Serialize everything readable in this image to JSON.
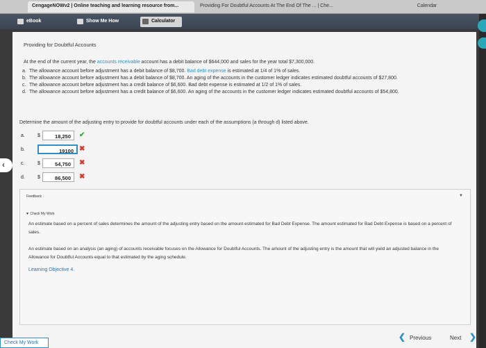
{
  "browser_tabs": [
    {
      "label": "CengageNOWv2 | Online teaching and learning resource from..."
    },
    {
      "label": "Providing For Doubtful Accounts At The End Of The ... | Che..."
    },
    {
      "label": "Calendar"
    }
  ],
  "toolbar": {
    "ebook": "eBook",
    "show_me_how": "Show Me How",
    "calculator": "Calculator"
  },
  "problem": {
    "title": "Providing for Doubtful Accounts",
    "intro_pre": "At the end of the current year, the ",
    "intro_link": "accounts receivable",
    "intro_post": " account has a debit balance of $644,000 and sales for the year total $7,300,000.",
    "items": [
      {
        "letter": "a.",
        "pre": "The allowance account before adjustment has a debit balance of $8,700. ",
        "link": "Bad debt expense",
        "post": " is estimated at 1/4 of 1% of sales."
      },
      {
        "letter": "b.",
        "pre": "The allowance account before adjustment has a debit balance of $8,700. An aging of the accounts in the customer ledger indicates estimated doubtful accounts of $27,800.",
        "link": "",
        "post": ""
      },
      {
        "letter": "c.",
        "pre": "The allowance account before adjustment has a credit balance of $6,600. Bad debt expense is estimated at 1/2 of 1% of sales.",
        "link": "",
        "post": ""
      },
      {
        "letter": "d.",
        "pre": "The allowance account before adjustment has a credit balance of $6,600. An aging of the accounts in the customer ledger indicates estimated doubtful accounts of $54,800.",
        "link": "",
        "post": ""
      }
    ],
    "determine": "Determine the amount of the adjusting entry to provide for doubtful accounts under each of the assumptions (a through d) listed above."
  },
  "answers": [
    {
      "letter": "a.",
      "currency": "$",
      "value": "18,250",
      "mark": "✔",
      "status": "correct"
    },
    {
      "letter": "b.",
      "currency": "$",
      "value": "19100",
      "mark": "✖",
      "status": "incorrect"
    },
    {
      "letter": "c.",
      "currency": "$",
      "value": "54,750",
      "mark": "✖",
      "status": "incorrect"
    },
    {
      "letter": "d.",
      "currency": "$",
      "value": "86,500",
      "mark": "✖",
      "status": "incorrect"
    }
  ],
  "feedback": {
    "label": "Feedback",
    "check_my_work": "▼ Check My Work",
    "para1": "An estimate based on a percent of sales determines the amount of the adjusting entry based on the amount estimated for Bad Debt Expense. The amount estimated for Bad Debt Expense is based on a percent of sales.",
    "para2": "An estimate based on an analysis (an aging) of accounts receivable focuses on the Allowance for Doubtful Accounts. The amount of the adjusting entry is the amount that will yield an adjusted balance in the Allowance for Doubtful Accounts equal to that estimated by the aging schedule.",
    "learning_objective": "Learning Objective 4."
  },
  "footer": {
    "check_my_work": "Check My Work",
    "previous": "Previous",
    "next": "Next"
  },
  "colors": {
    "accent": "#2e8fc6",
    "correct": "#3aa83a",
    "incorrect": "#d23a2a"
  }
}
